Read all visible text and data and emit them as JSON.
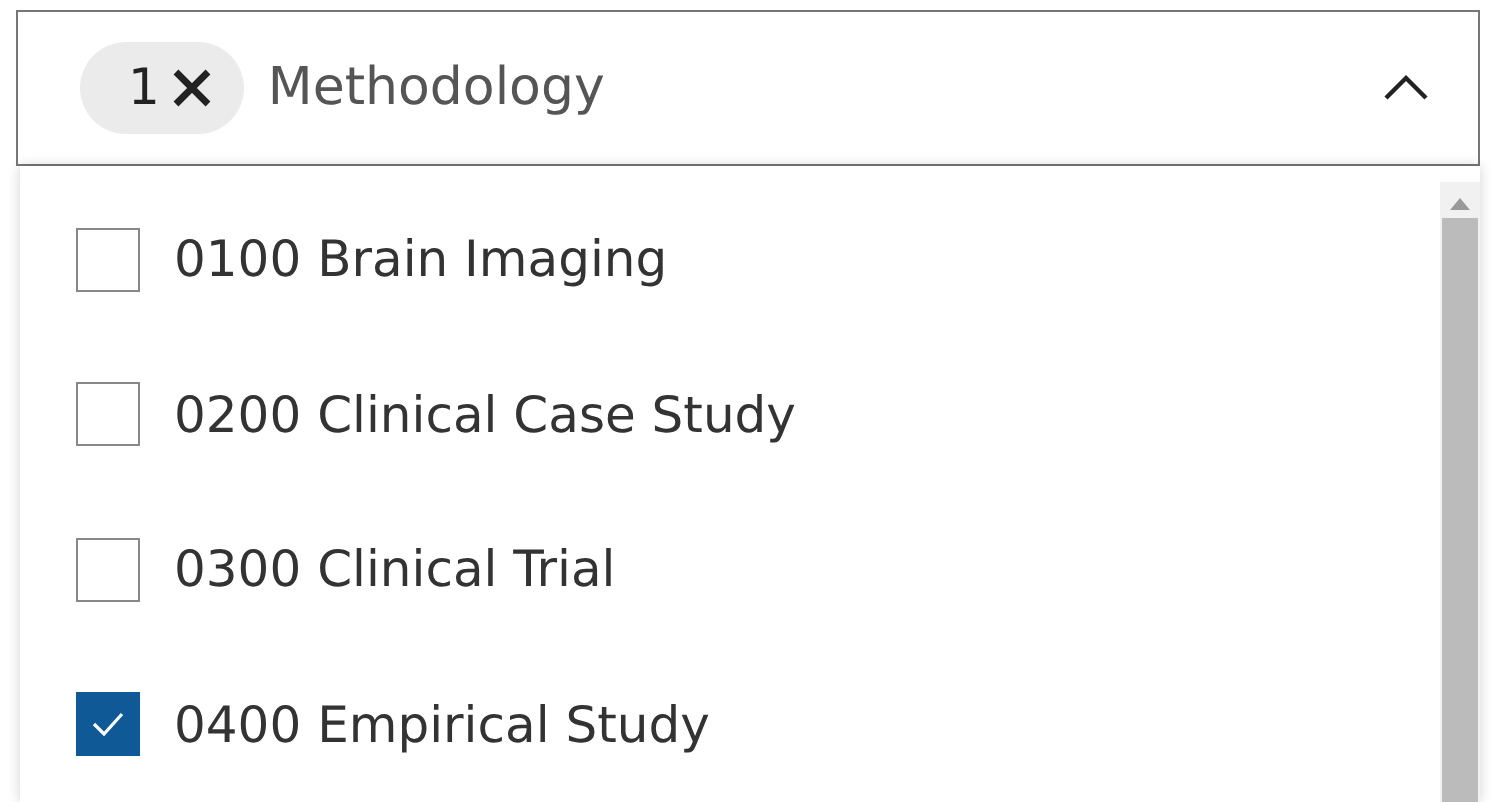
{
  "filter": {
    "count": "1",
    "label": "Methodology",
    "expanded": true
  },
  "options": [
    {
      "label": "0100 Brain Imaging",
      "checked": false
    },
    {
      "label": "0200 Clinical Case Study",
      "checked": false
    },
    {
      "label": "0300 Clinical Trial",
      "checked": false
    },
    {
      "label": "0400 Empirical Study",
      "checked": true
    }
  ]
}
